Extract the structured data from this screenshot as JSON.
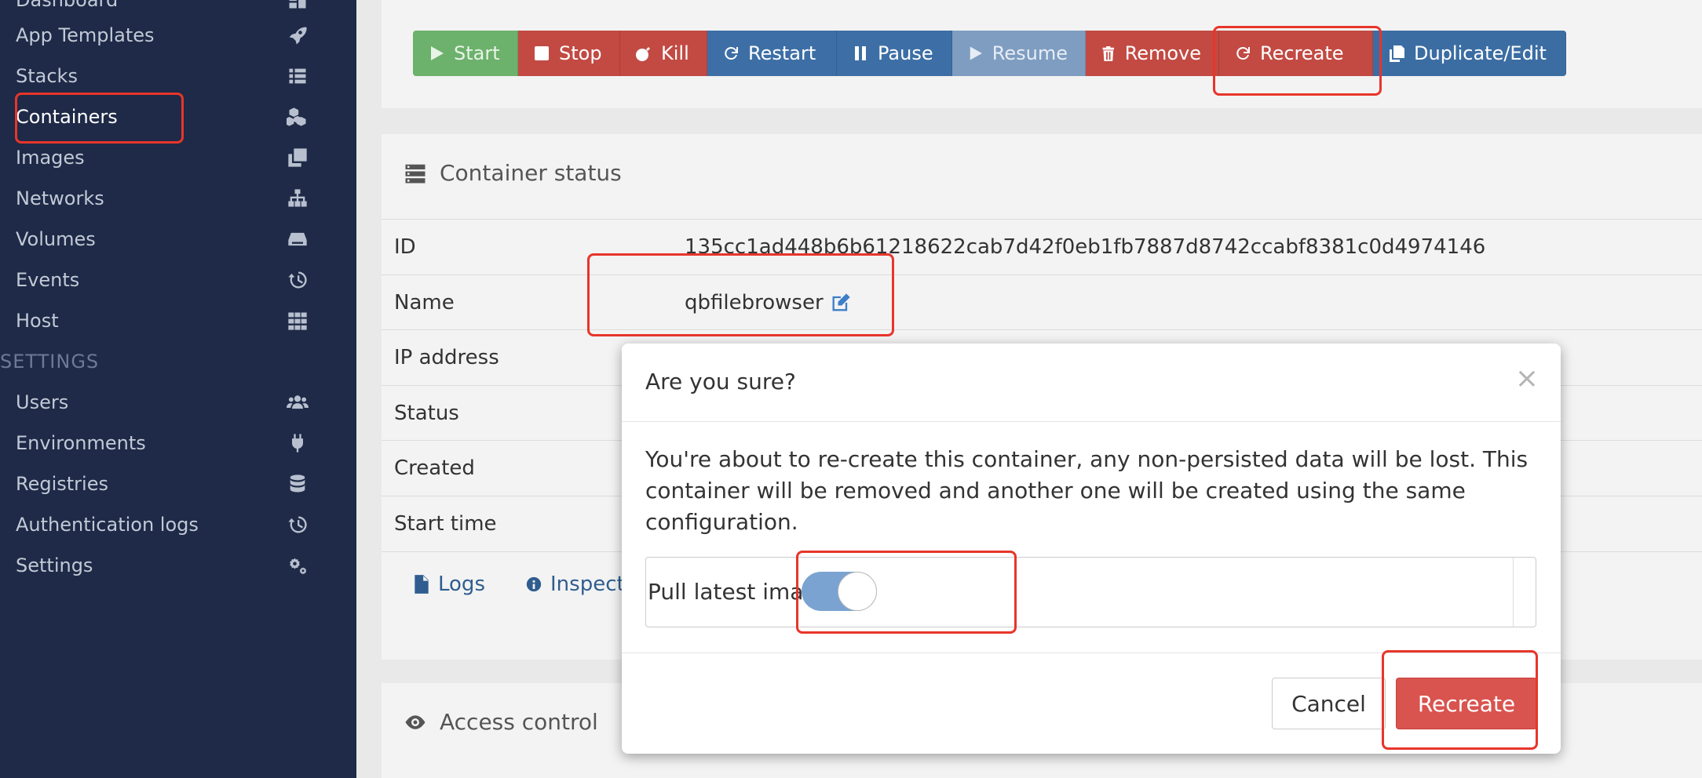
{
  "sidebar": {
    "items": [
      {
        "label": "Dashboard",
        "icon": "dashboard-icon"
      },
      {
        "label": "App Templates",
        "icon": "rocket-icon"
      },
      {
        "label": "Stacks",
        "icon": "list-icon"
      },
      {
        "label": "Containers",
        "icon": "cubes-icon"
      },
      {
        "label": "Images",
        "icon": "clone-icon"
      },
      {
        "label": "Networks",
        "icon": "sitemap-icon"
      },
      {
        "label": "Volumes",
        "icon": "hdd-icon"
      },
      {
        "label": "Events",
        "icon": "history-icon"
      },
      {
        "label": "Host",
        "icon": "th-icon"
      }
    ],
    "settings_section": "SETTINGS",
    "settings_items": [
      {
        "label": "Users",
        "icon": "users-icon"
      },
      {
        "label": "Environments",
        "icon": "plug-icon"
      },
      {
        "label": "Registries",
        "icon": "database-icon"
      },
      {
        "label": "Authentication logs",
        "icon": "history-icon"
      },
      {
        "label": "Settings",
        "icon": "cogs-icon"
      }
    ]
  },
  "toolbar": {
    "start": "Start",
    "stop": "Stop",
    "kill": "Kill",
    "restart": "Restart",
    "pause": "Pause",
    "resume": "Resume",
    "remove": "Remove",
    "recreate": "Recreate",
    "duplicate": "Duplicate/Edit"
  },
  "status": {
    "title": "Container status",
    "id_label": "ID",
    "id_value": "135cc1ad448b6b61218622cab7d42f0eb1fb7887d8742ccabf8381c0d4974146",
    "name_label": "Name",
    "name_value": "qbfilebrowser",
    "ip_label": "IP address",
    "status_label": "Status",
    "created_label": "Created",
    "start_time_label": "Start time",
    "logs_link": "Logs",
    "inspect_link": "Inspect"
  },
  "access": {
    "title": "Access control"
  },
  "modal": {
    "title": "Are you sure?",
    "close": "×",
    "body": "You're about to re-create this container, any non-persisted data will be lost. This container will be removed and another one will be created using the same configuration.",
    "toggle_label": "Pull latest image",
    "toggle_on": true,
    "cancel": "Cancel",
    "confirm": "Recreate"
  },
  "colors": {
    "sidebar_bg": "#1e2a47",
    "danger": "#d9534f",
    "primary": "#3d6fa6",
    "annotation": "#e8352a"
  }
}
